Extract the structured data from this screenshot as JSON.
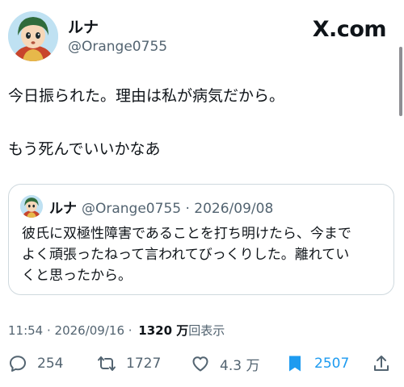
{
  "author": {
    "name": "ルナ",
    "handle": "@Orange0755"
  },
  "brand": {
    "label": "X.com"
  },
  "tweet": {
    "lines": [
      "今日振られた。理由は私が病気だから。",
      "もう死んでいいかなあ"
    ]
  },
  "quote": {
    "name": "ルナ",
    "handle_date": "@Orange0755 · 2026/09/08",
    "lines": [
      "彼氏に双極性障害であることを打ち明けたら、今まで",
      "よく頑張ったねって言われてびっくりした。離れてい",
      "くと思ったから。"
    ]
  },
  "meta": {
    "time_date": "11:54 · 2026/09/16 · ",
    "views_count": "1320 万",
    "views_label": "回表示"
  },
  "actions": {
    "replies": "254",
    "reposts": "1727",
    "likes": "4.3 万",
    "bookmarks": "2507"
  },
  "colors": {
    "text": "#0f1419",
    "secondary": "#536471",
    "accent": "#1d9bf0",
    "border": "#cfd9de"
  },
  "icons": [
    "reply-icon",
    "repost-icon",
    "like-icon",
    "bookmark-icon",
    "share-icon"
  ]
}
